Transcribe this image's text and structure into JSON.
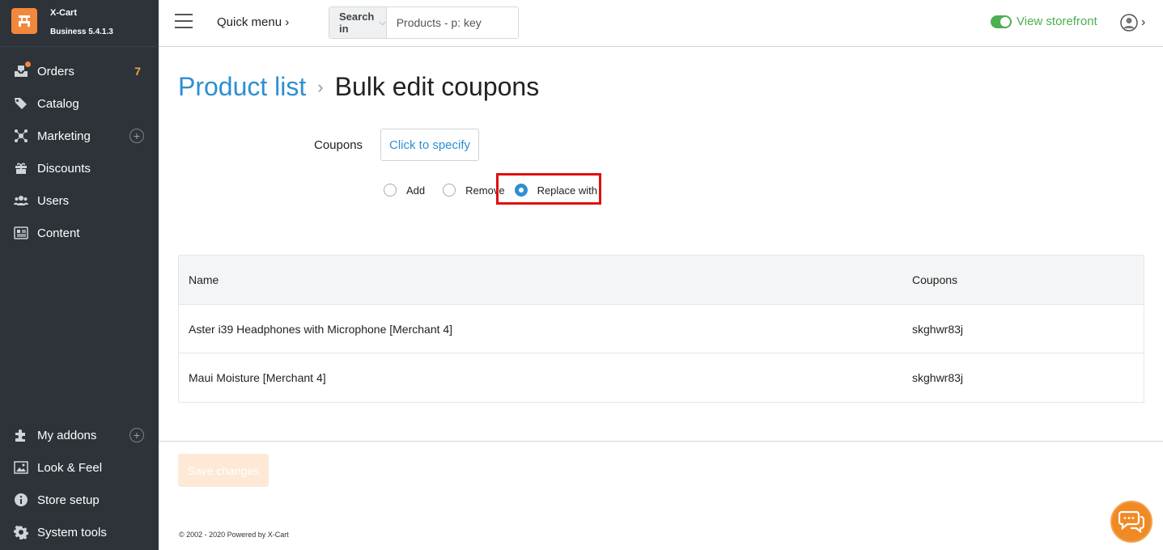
{
  "brand": {
    "name": "X-Cart",
    "version": "Business 5.4.1.3"
  },
  "sidebar": {
    "items": [
      {
        "label": "Orders",
        "badge": "7"
      },
      {
        "label": "Catalog"
      },
      {
        "label": "Marketing"
      },
      {
        "label": "Discounts"
      },
      {
        "label": "Users"
      },
      {
        "label": "Content"
      }
    ],
    "bottom_items": [
      {
        "label": "My addons"
      },
      {
        "label": "Look & Feel"
      },
      {
        "label": "Store setup"
      },
      {
        "label": "System tools"
      }
    ]
  },
  "header": {
    "quick_menu": "Quick menu",
    "search_scope": "Search in",
    "search_placeholder": "Products - p: key",
    "storefront_label": "View storefront"
  },
  "breadcrumb": {
    "parent": "Product list",
    "current": "Bulk edit coupons"
  },
  "form": {
    "coupons_label": "Coupons",
    "specify_button": "Click to specify",
    "options": [
      {
        "label": "Add",
        "checked": false
      },
      {
        "label": "Remove",
        "checked": false
      },
      {
        "label": "Replace with",
        "checked": true
      }
    ]
  },
  "table": {
    "columns": [
      "Name",
      "Coupons"
    ],
    "rows": [
      {
        "name": "Aster i39 Headphones with Microphone [Merchant 4]",
        "coupons": "skghwr83j"
      },
      {
        "name": "Maui Moisture [Merchant 4]",
        "coupons": "skghwr83j"
      }
    ]
  },
  "footer": {
    "save_button": "Save changes",
    "copyright": "© 2002 - 2020 Powered by X-Cart"
  },
  "colors": {
    "sidebar_bg": "#2d3339",
    "accent_orange": "#f3873c",
    "link_blue": "#2e8fd1",
    "storefront_green": "#4caf50",
    "highlight_red": "#e01010"
  }
}
